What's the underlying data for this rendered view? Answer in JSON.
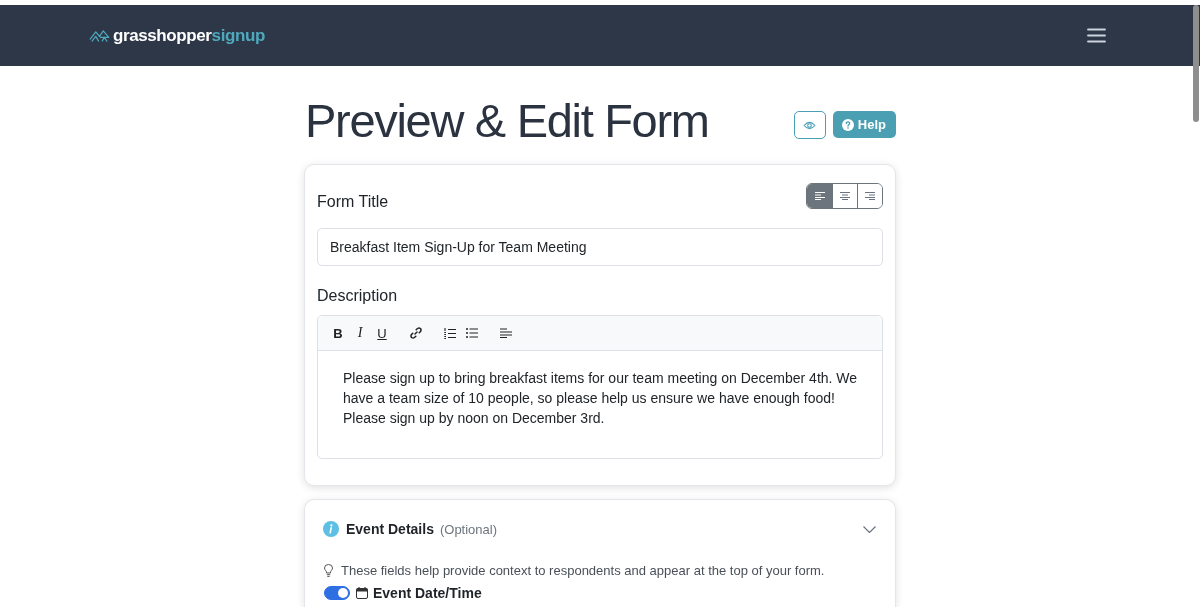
{
  "header": {
    "logo": {
      "text": "grasshopper",
      "accent": "signup"
    }
  },
  "title_bar": {
    "title": "Preview & Edit Form",
    "help_label": "Help"
  },
  "form_card": {
    "title_label": "Form Title",
    "alignment": [
      {
        "kind": "left",
        "selected": true
      },
      {
        "kind": "center",
        "selected": false
      },
      {
        "kind": "right",
        "selected": false
      }
    ],
    "title_value": "Breakfast Item Sign-Up for Team Meeting",
    "description_label": "Description",
    "toolbar": [
      {
        "buttons": [
          {
            "kind": "bold",
            "label": "B"
          },
          {
            "kind": "italic",
            "label": "I"
          },
          {
            "kind": "underline",
            "label": "U"
          }
        ]
      },
      {
        "buttons": [
          {
            "kind": "link"
          }
        ]
      },
      {
        "buttons": [
          {
            "kind": "ordered-list"
          },
          {
            "kind": "bullet-list"
          }
        ]
      },
      {
        "buttons": [
          {
            "kind": "align-left"
          }
        ]
      }
    ],
    "description": "Please sign up to bring breakfast items for our team meeting on December 4th. We have a team size of 10 people, so please help us ensure we have enough food! Please sign up by noon on December 3rd."
  },
  "event_details": {
    "title": "Event Details",
    "note": "(Optional)",
    "expanded": true,
    "hint": "These fields help provide context to respondents and appear at the top of your form.",
    "fields": [
      {
        "label": "Event Date/Time",
        "on": true
      }
    ]
  }
}
